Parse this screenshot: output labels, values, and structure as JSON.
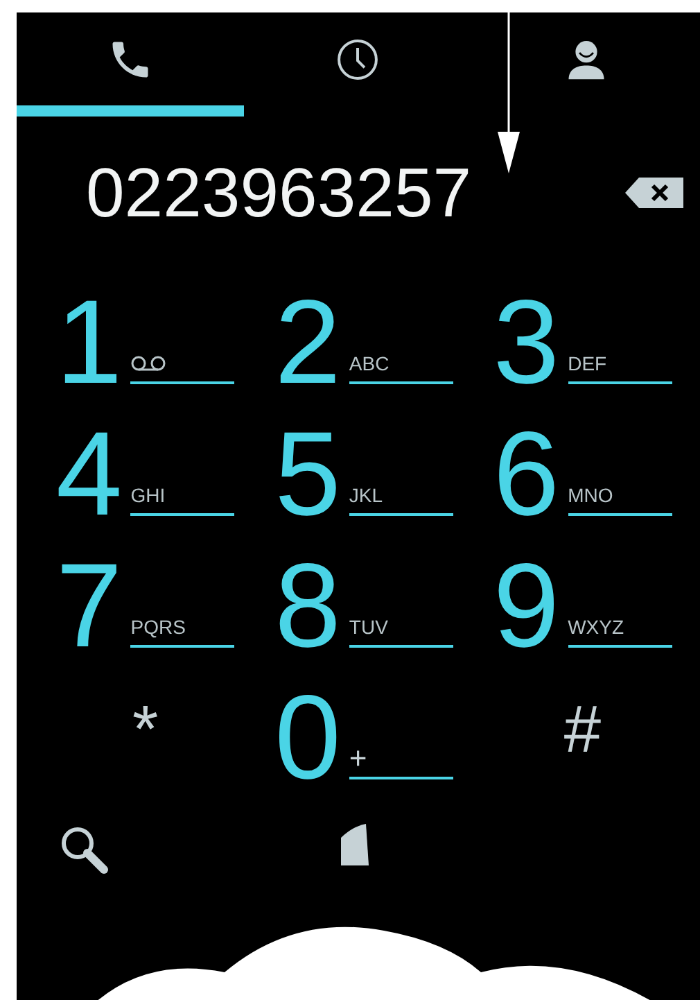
{
  "tabs": [
    {
      "selected": true
    },
    {
      "selected": false
    },
    {
      "selected": false
    }
  ],
  "display": {
    "number": "0223963257"
  },
  "keypad": [
    {
      "kind": "voicemail",
      "digit": "1"
    },
    {
      "kind": "digit",
      "digit": "2",
      "letters": "ABC"
    },
    {
      "kind": "digit",
      "digit": "3",
      "letters": "DEF"
    },
    {
      "kind": "digit",
      "digit": "4",
      "letters": "GHI"
    },
    {
      "kind": "digit",
      "digit": "5",
      "letters": "JKL"
    },
    {
      "kind": "digit",
      "digit": "6",
      "letters": "MNO"
    },
    {
      "kind": "digit",
      "digit": "7",
      "letters": "PQRS"
    },
    {
      "kind": "digit",
      "digit": "8",
      "letters": "TUV"
    },
    {
      "kind": "digit",
      "digit": "9",
      "letters": "WXYZ"
    },
    {
      "kind": "symbol",
      "digit": "*"
    },
    {
      "kind": "digit",
      "digit": "0",
      "letters": "+"
    },
    {
      "kind": "symbol",
      "digit": "#"
    }
  ]
}
